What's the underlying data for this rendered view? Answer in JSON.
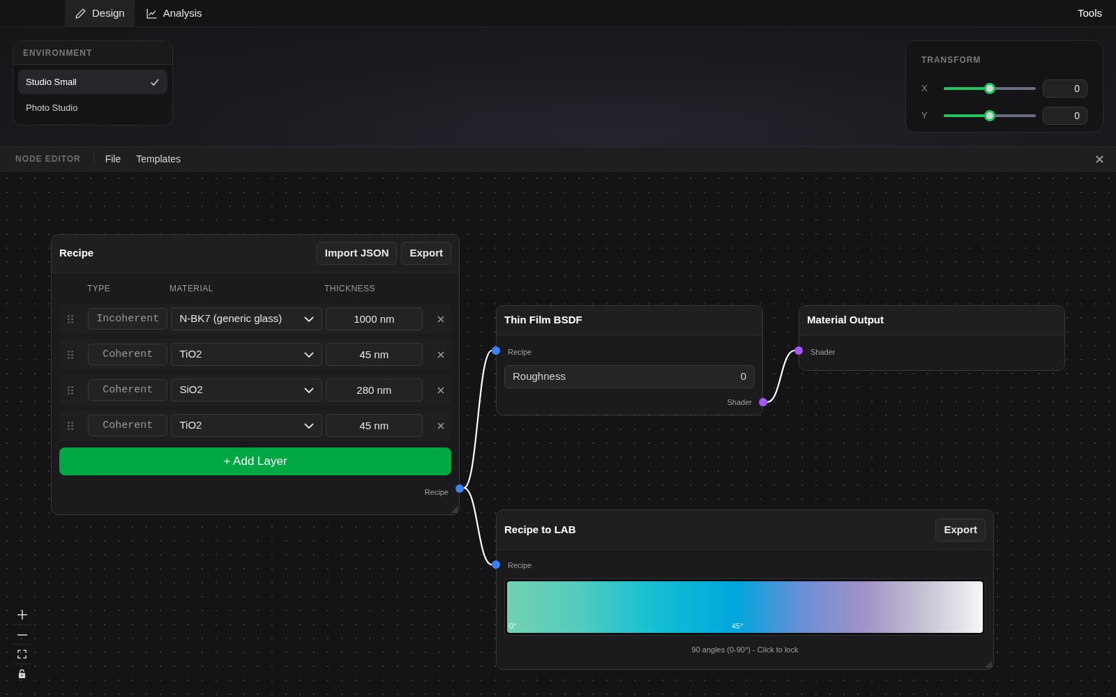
{
  "top_tabs": [
    {
      "label": "Design",
      "selected": true
    },
    {
      "label": "Analysis",
      "selected": false
    }
  ],
  "tools_button": "Tools",
  "environment": {
    "title": "ENVIRONMENT",
    "options": [
      {
        "label": "Studio Small",
        "selected": true
      },
      {
        "label": "Photo Studio",
        "selected": false
      }
    ]
  },
  "transform": {
    "title": "TRANSFORM",
    "sliders": [
      {
        "axis": "X",
        "level": 0.5,
        "value": "0"
      },
      {
        "axis": "Y",
        "level": 0.5,
        "value": "0"
      }
    ]
  },
  "node_editor": {
    "title": "NODE EDITOR",
    "menu": [
      "File",
      "Templates"
    ]
  },
  "recipe_node": {
    "title": "Recipe",
    "buttons": [
      "Import JSON",
      "Export"
    ],
    "columns": [
      "TYPE",
      "MATERIAL",
      "THICKNESS"
    ],
    "layers": [
      {
        "type": "Incoherent",
        "material": "N-BK7 (generic glass)",
        "thickness": "1000 nm"
      },
      {
        "type": "Coherent",
        "material": "TiO2",
        "thickness": "45 nm"
      },
      {
        "type": "Coherent",
        "material": "SiO2",
        "thickness": "280 nm"
      },
      {
        "type": "Coherent",
        "material": "TiO2",
        "thickness": "45 nm"
      }
    ],
    "add_button": "+ Add Layer",
    "output": "Recipe"
  },
  "thin_film_node": {
    "title": "Thin Film BSDF",
    "input": "Recipe",
    "field": {
      "label": "Roughness",
      "value": "0"
    },
    "output": "Shader"
  },
  "material_output_node": {
    "title": "Material Output",
    "input": "Shader"
  },
  "lab_node": {
    "title": "Recipe to LAB",
    "button": "Export",
    "input": "Recipe",
    "gradient_labels": [
      "0°",
      "45°"
    ],
    "caption": "90 angles (0-90°) - Click to lock"
  }
}
